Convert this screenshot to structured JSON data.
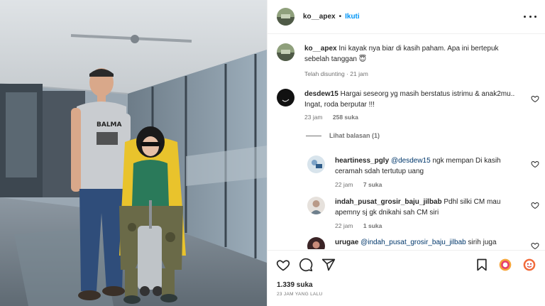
{
  "post": {
    "username": "ko__apex",
    "separator": "•",
    "follow_label": "Ikuti",
    "caption_user": "ko__apex",
    "caption_text": "Ini kayak nya biar di kasih paham. Apa ini bertepuk sebelah tanggan 😇",
    "caption_meta": "Telah disunting · 21 jam"
  },
  "comments": [
    {
      "user": "desdew15",
      "text": "Hargai seseorg yg masih berstatus istrimu & anak2mu.. Ingat, roda berputar !!!",
      "time": "23 jam",
      "likes": "258 suka"
    }
  ],
  "view_replies": "Lihat balasan (1)",
  "replies": [
    {
      "user": "heartiness_pgly",
      "mention": "@desdew15",
      "text": "ngk mempan Di kasih ceramah sdah tertutup uang",
      "time": "22 jam",
      "likes": "7 suka"
    },
    {
      "user": "indah_pusat_grosir_baju_jilbab",
      "text": "Pdhl silki CM mau apemny sj gk dnikahi sah CM siri",
      "time": "22 jam",
      "likes": "1 suka"
    },
    {
      "user": "urugae",
      "mention": "@indah_pusat_grosir_baju_jilbab",
      "text": "sirih juga"
    }
  ],
  "footer": {
    "likes": "1.339 suka",
    "time_ago": "23 JAM YANG LALU"
  },
  "photo": {
    "shirt_text": "BALMA"
  },
  "colors": {
    "link_blue": "#0095f6",
    "mention_blue": "#00376b",
    "muted": "#737373"
  },
  "icons": [
    "heart-icon",
    "comment-icon",
    "share-icon",
    "bookmark-icon",
    "more-icon"
  ]
}
